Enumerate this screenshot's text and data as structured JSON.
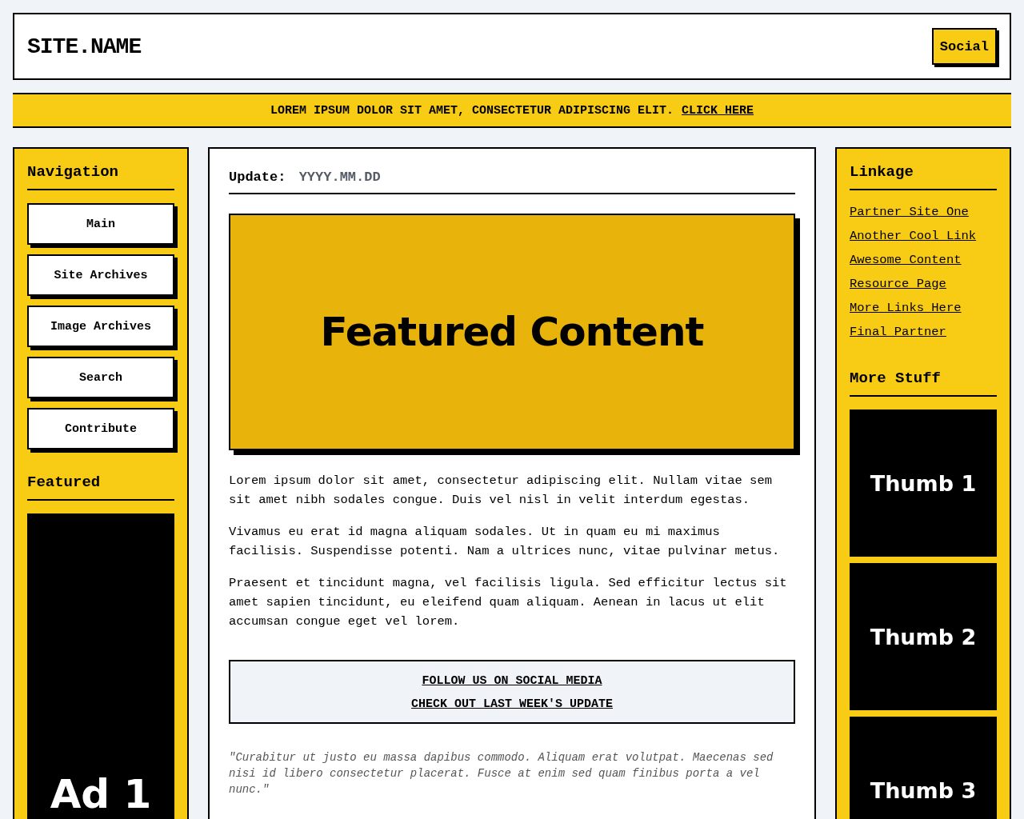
{
  "header": {
    "site_name": "SITE.NAME",
    "social_button": "Social"
  },
  "banner": {
    "text": "LOREM IPSUM DOLOR SIT AMET, CONSECTETUR ADIPISCING ELIT.",
    "link": "CLICK HERE"
  },
  "left_sidebar": {
    "navigation_title": "Navigation",
    "nav_items": [
      "Main",
      "Site Archives",
      "Image Archives",
      "Search",
      "Contribute"
    ],
    "featured_title": "Featured",
    "ad": {
      "label": "Ad 1"
    }
  },
  "main": {
    "update_label": "Update:",
    "update_date": "YYYY.MM.DD",
    "featured_box": "Featured Content",
    "paragraphs": [
      "Lorem ipsum dolor sit amet, consectetur adipiscing elit. Nullam vitae sem sit amet nibh sodales congue. Duis vel nisl in velit interdum egestas.",
      "Vivamus eu erat id magna aliquam sodales. Ut in quam eu mi maximus facilisis. Suspendisse potenti. Nam a ultrices nunc, vitae pulvinar metus.",
      "Praesent et tincidunt magna, vel facilisis ligula. Sed efficitur lectus sit amet sapien tincidunt, eu eleifend quam aliquam. Aenean in lacus ut elit accumsan congue eget vel lorem."
    ],
    "links": [
      "FOLLOW US ON SOCIAL MEDIA",
      "CHECK OUT LAST WEEK'S UPDATE"
    ],
    "quote": "\"Curabitur ut justo eu massa dapibus commodo. Aliquam erat volutpat. Maecenas sed nisi id libero consectetur placerat. Fusce at enim sed quam finibus porta a vel nunc.\""
  },
  "right_sidebar": {
    "linkage_title": "Linkage",
    "links": [
      "Partner Site One",
      "Another Cool Link",
      "Awesome Content",
      "Resource Page",
      "More Links Here",
      "Final Partner"
    ],
    "more_title": "More Stuff",
    "thumbs": [
      "Thumb 1",
      "Thumb 2",
      "Thumb 3"
    ]
  }
}
